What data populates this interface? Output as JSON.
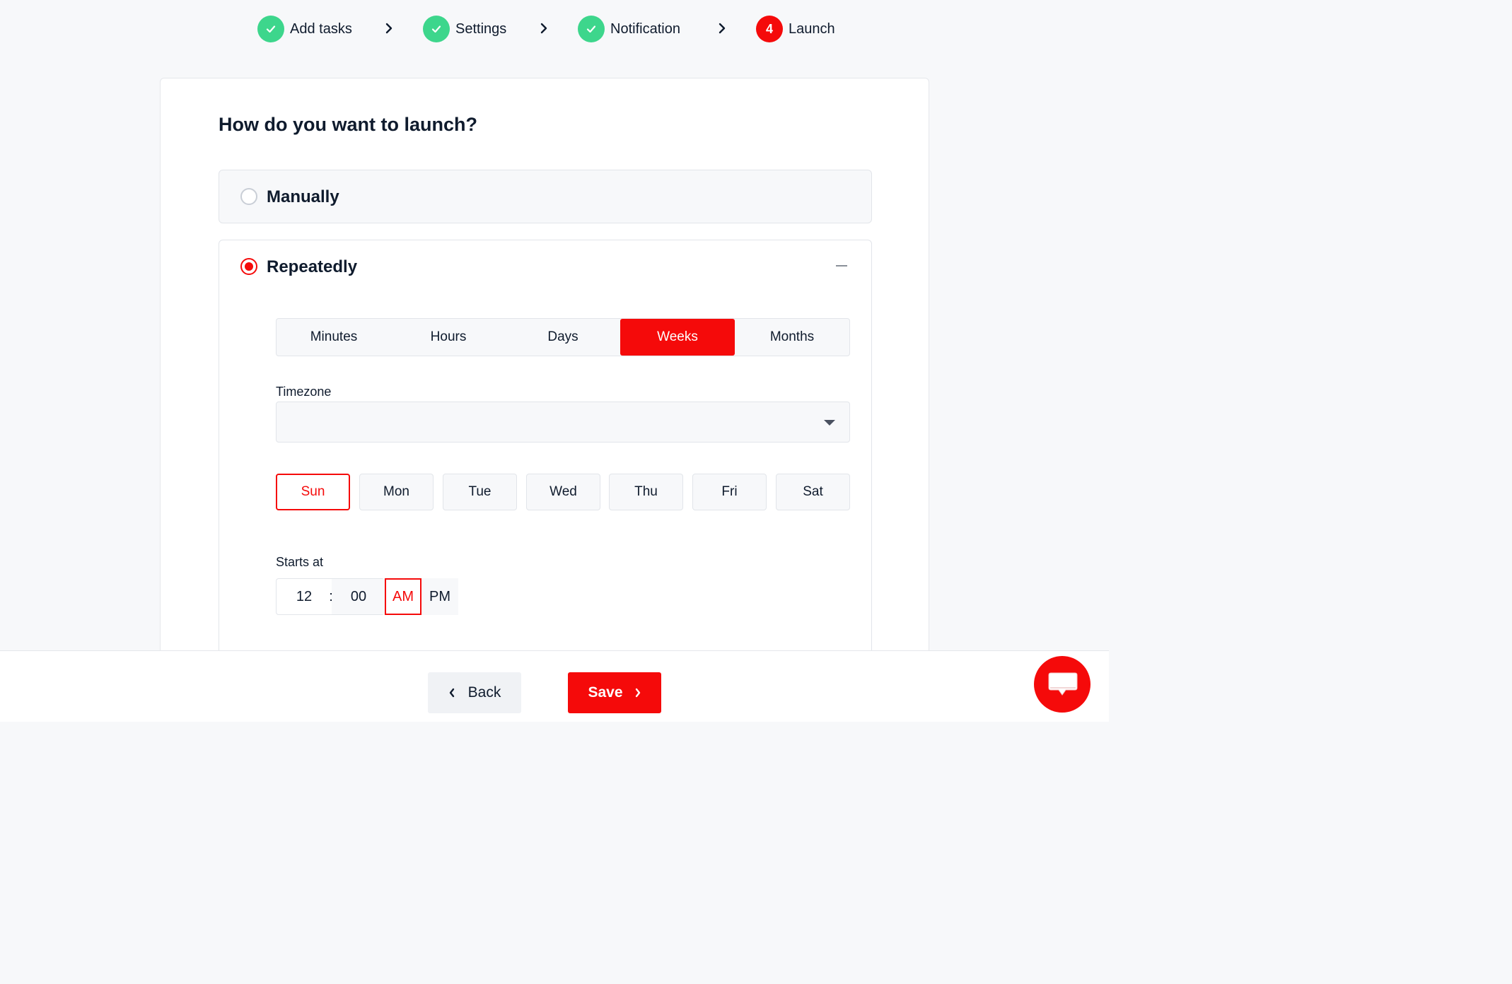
{
  "stepper": {
    "steps": [
      {
        "label": "Add tasks",
        "state": "done"
      },
      {
        "label": "Settings",
        "state": "done"
      },
      {
        "label": "Notification",
        "state": "done"
      },
      {
        "label": "Launch",
        "state": "active",
        "number": "4"
      }
    ]
  },
  "main": {
    "title": "How do you want to launch?",
    "options": {
      "manual": {
        "label": "Manually",
        "selected": false
      },
      "repeat": {
        "label": "Repeatedly",
        "selected": true
      }
    },
    "frequency": {
      "tabs": [
        "Minutes",
        "Hours",
        "Days",
        "Weeks",
        "Months"
      ],
      "selected": "Weeks"
    },
    "timezone": {
      "label": "Timezone",
      "value": ""
    },
    "days": {
      "items": [
        "Sun",
        "Mon",
        "Tue",
        "Wed",
        "Thu",
        "Fri",
        "Sat"
      ],
      "selected": "Sun"
    },
    "start": {
      "label": "Starts at",
      "hour": "12",
      "separator": ":",
      "minute": "00",
      "am": "AM",
      "pm": "PM",
      "period": "AM"
    }
  },
  "footer": {
    "back_label": "Back",
    "save_label": "Save"
  },
  "colors": {
    "accent": "#f50a0a",
    "done": "#3dd68c",
    "text": "#0f1b2d"
  }
}
